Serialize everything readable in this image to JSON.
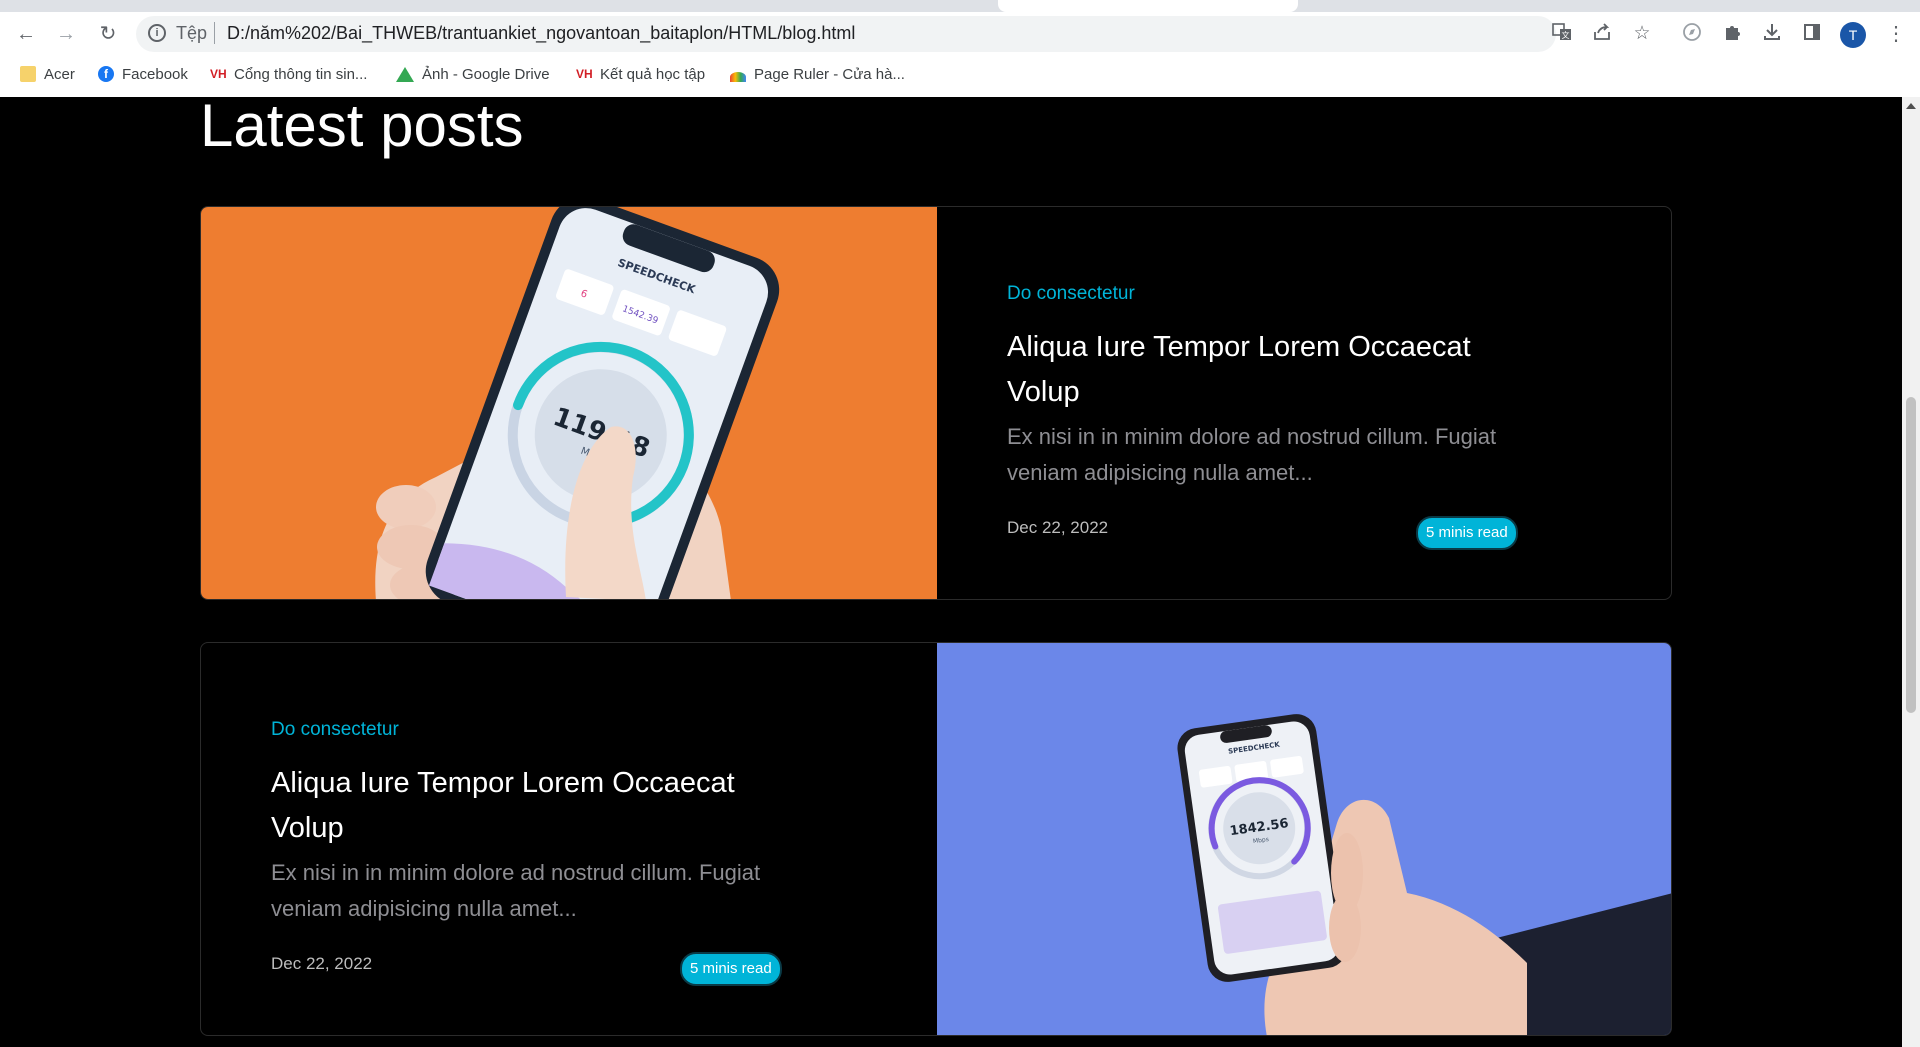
{
  "browser": {
    "url_scheme": "Tệp",
    "url": "D:/năm%202/Bai_THWEB/trantuankiet_ngovantoan_baitaplon/HTML/blog.html",
    "profile_initial": "T",
    "bookmarks": [
      {
        "label": "Acer",
        "icon": "folder-icon"
      },
      {
        "label": "Facebook",
        "icon": "facebook-icon"
      },
      {
        "label": "Cổng thông tin sin...",
        "icon": "university-icon"
      },
      {
        "label": "Ảnh - Google Drive",
        "icon": "google-drive-icon"
      },
      {
        "label": "Kết quả học tập",
        "icon": "university-icon"
      },
      {
        "label": "Page Ruler - Cửa hà...",
        "icon": "page-ruler-icon"
      }
    ],
    "university_glyph": "VH"
  },
  "page": {
    "heading": "Latest posts",
    "posts": [
      {
        "category": "Do consectetur",
        "title": "Aliqua Iure Tempor Lorem Occaecat Volup",
        "excerpt": "Ex nisi in in minim dolore ad nostrud cillum. Fugiat veniam adipisicing nulla amet...",
        "date": "Dec 22, 2022",
        "read_time": "5 minis read",
        "image_bg": "#ee7d30",
        "phone_screen_value": "119.18",
        "phone_screen_unit": "Mbps",
        "phone_app": "SPEEDCHECK",
        "phone_stat_1": "6",
        "phone_stat_2": "1542.39"
      },
      {
        "category": "Do consectetur",
        "title": "Aliqua Iure Tempor Lorem Occaecat Volup",
        "excerpt": "Ex nisi in in minim dolore ad nostrud cillum. Fugiat veniam adipisicing nulla amet...",
        "date": "Dec 22, 2022",
        "read_time": "5 minis read",
        "image_bg": "#6b87e9",
        "phone_screen_value": "1842.56",
        "phone_screen_unit": "Mbps",
        "phone_app": "SPEEDCHECK"
      }
    ]
  },
  "colors": {
    "accent": "#00b4d8",
    "page_bg": "#000000"
  }
}
